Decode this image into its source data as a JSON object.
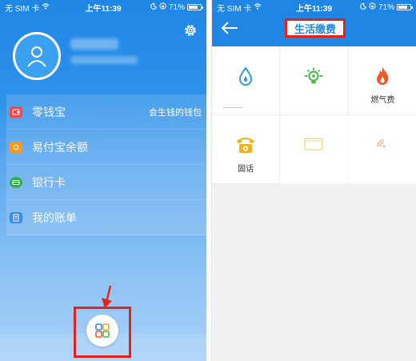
{
  "left": {
    "status": {
      "carrier": "无 SIM 卡",
      "time": "上午11:39",
      "battery": "71%"
    },
    "menu": [
      {
        "label": "零钱宝",
        "tag": "会生钱的钱包",
        "icon": "wallet-icon",
        "color": "#f04848"
      },
      {
        "label": "易付宝余额",
        "tag": "",
        "icon": "balance-icon",
        "color": "#f59d1b"
      },
      {
        "label": "银行卡",
        "tag": "",
        "icon": "card-icon",
        "color": "#2bb34a"
      },
      {
        "label": "我的账单",
        "tag": "",
        "icon": "bill-icon",
        "color": "#3d8fe0"
      }
    ],
    "icons": {
      "settings": "gear-icon",
      "launcher": "grid-apps-icon",
      "pointer": "arrow-down-icon"
    }
  },
  "right": {
    "status": {
      "carrier": "无 SIM 卡",
      "time": "上午11:39",
      "battery": "71%"
    },
    "title": "生活缴费",
    "services": [
      {
        "label": "",
        "icon": "water-drop-icon",
        "color": "#2c9ae8"
      },
      {
        "label": "",
        "icon": "bulb-icon",
        "color": "#47b84a"
      },
      {
        "label": "燃气费",
        "icon": "flame-icon",
        "color": "#f05a2b"
      },
      {
        "label": "固话",
        "icon": "telephone-icon",
        "color": "#f2b21a"
      },
      {
        "label": "",
        "icon": "tv-icon",
        "color": "#f2a81d"
      },
      {
        "label": "",
        "icon": "broadband-icon",
        "color": "#f05a2b"
      }
    ]
  },
  "colors": {
    "primary": "#1f86e6",
    "highlight": "#e2231a"
  }
}
